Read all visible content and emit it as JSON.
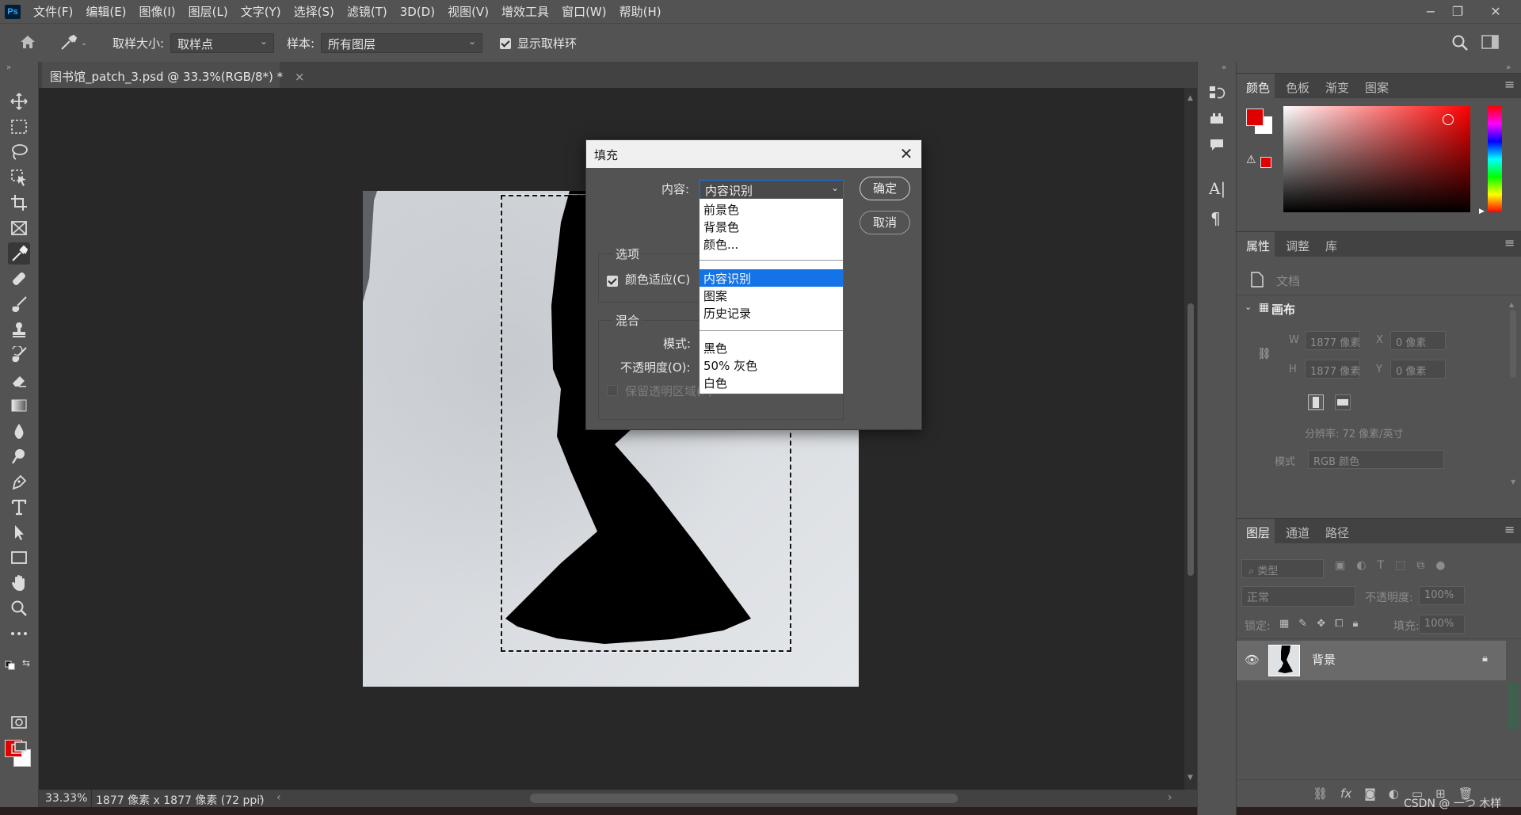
{
  "app": {
    "logo": "Ps"
  },
  "menubar": {
    "items": [
      "文件(F)",
      "编辑(E)",
      "图像(I)",
      "图层(L)",
      "文字(Y)",
      "选择(S)",
      "滤镜(T)",
      "3D(D)",
      "视图(V)",
      "增效工具",
      "窗口(W)",
      "帮助(H)"
    ],
    "minimize": "−",
    "restore": "❐",
    "close": "✕"
  },
  "options": {
    "sample_size_label": "取样大小:",
    "sample_size_value": "取样点",
    "sample_label": "样本:",
    "sample_value": "所有图层",
    "show_ring_label": "显示取样环"
  },
  "document": {
    "tab_title": "图书馆_patch_3.psd @ 33.3%(RGB/8*) *",
    "tab_close": "×"
  },
  "status": {
    "zoom": "33.33%",
    "info": "1877 像素 x 1877 像素 (72 ppi)",
    "arrow": "›",
    "left_arrow": "‹",
    "right_arrow": "›"
  },
  "dialog": {
    "title": "填充",
    "close": "✕",
    "content_label": "内容:",
    "content_value": "内容识别",
    "ok": "确定",
    "cancel": "取消",
    "options_group": "选项",
    "color_adapt": "颜色适应(C)",
    "blend_group": "混合",
    "mode_label": "模式:",
    "opacity_label": "不透明度(O):",
    "preserve": "保留透明区域(P)"
  },
  "dropdown": {
    "items": [
      "前景色",
      "背景色",
      "颜色...",
      "内容识别",
      "图案",
      "历史记录",
      "黑色",
      "50% 灰色",
      "白色"
    ],
    "selected": "内容识别"
  },
  "color_panel": {
    "tabs": [
      "颜色",
      "色板",
      "渐变",
      "图案"
    ],
    "foreground": "#e00000",
    "background": "#ffffff"
  },
  "properties_panel": {
    "tabs": [
      "属性",
      "调整",
      "库"
    ],
    "doc_label": "文档",
    "canvas_label": "画布",
    "w_label": "W",
    "w_value": "1877 像素",
    "h_label": "H",
    "h_value": "1877 像素",
    "x_label": "X",
    "x_value": "0 像素",
    "y_label": "Y",
    "y_value": "0 像素",
    "resolution": "分辨率: 72 像素/英寸",
    "mode_label": "模式",
    "mode_value": "RGB 颜色"
  },
  "layers_panel": {
    "tabs": [
      "图层",
      "通道",
      "路径"
    ],
    "filter_placeholder": "类型",
    "blend_mode": "正常",
    "opacity_label": "不透明度:",
    "opacity_value": "100%",
    "lock_label": "锁定:",
    "fill_label": "填充:",
    "fill_value": "100%",
    "layers": [
      {
        "name": "背景"
      }
    ],
    "fx_label": "fx"
  },
  "watermark": "CSDN @ 一つ 木样"
}
